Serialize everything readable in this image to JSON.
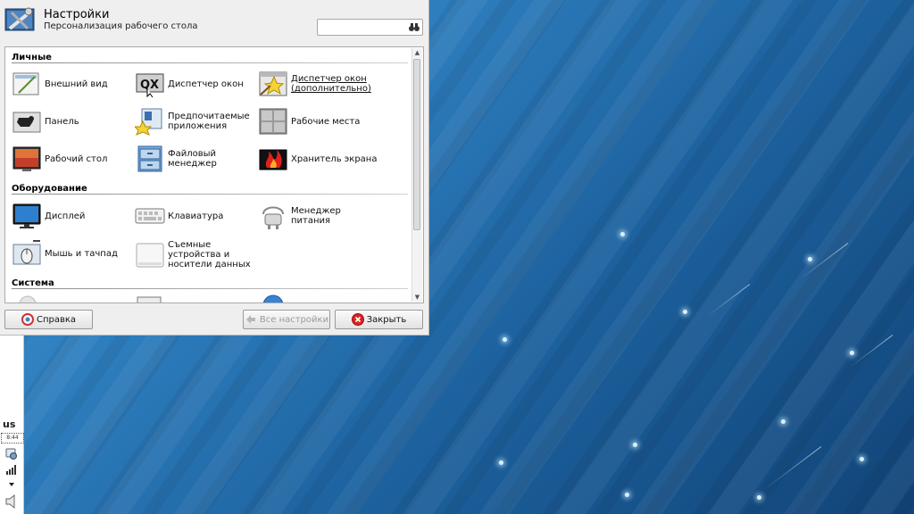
{
  "window": {
    "title": "Настройки",
    "subtitle": "Персонализация рабочего стола",
    "search": {
      "value": "",
      "placeholder": ""
    }
  },
  "categories": [
    {
      "label": "Личные",
      "items": [
        {
          "label": "Внешний вид",
          "icon": "appearance-icon"
        },
        {
          "label": "Диспетчер окон",
          "icon": "window-manager-icon"
        },
        {
          "label": "Диспетчер окон\n(дополнительно)",
          "icon": "window-manager-tweaks-icon"
        },
        {
          "label": "Панель",
          "icon": "panel-icon"
        },
        {
          "label": "Предпочитаемые\nприложения",
          "icon": "preferred-apps-icon"
        },
        {
          "label": "Рабочие места",
          "icon": "workspaces-icon"
        },
        {
          "label": "Рабочий стол",
          "icon": "desktop-icon"
        },
        {
          "label": "Файловый\nменеджер",
          "icon": "file-manager-icon"
        },
        {
          "label": "Хранитель экрана",
          "icon": "screensaver-icon"
        }
      ]
    },
    {
      "label": "Оборудование",
      "items": [
        {
          "label": "Дисплей",
          "icon": "display-icon"
        },
        {
          "label": "Клавиатура",
          "icon": "keyboard-icon"
        },
        {
          "label": "Менеджер\nпитания",
          "icon": "power-manager-icon"
        },
        {
          "label": "Мышь и тачпад",
          "icon": "mouse-touchpad-icon"
        },
        {
          "label": "Съемные\nустройства и\nносители данных",
          "icon": "removable-drives-icon"
        }
      ]
    },
    {
      "label": "Система",
      "items": []
    }
  ],
  "buttons": {
    "help": "Справка",
    "all_settings": "Все настройки",
    "close": "Закрыть"
  },
  "panel": {
    "keyboard_layout": "us",
    "clock": "8:44"
  },
  "colors": {
    "desktop_blue": "#1b5d98",
    "window_bg": "#efefef"
  }
}
